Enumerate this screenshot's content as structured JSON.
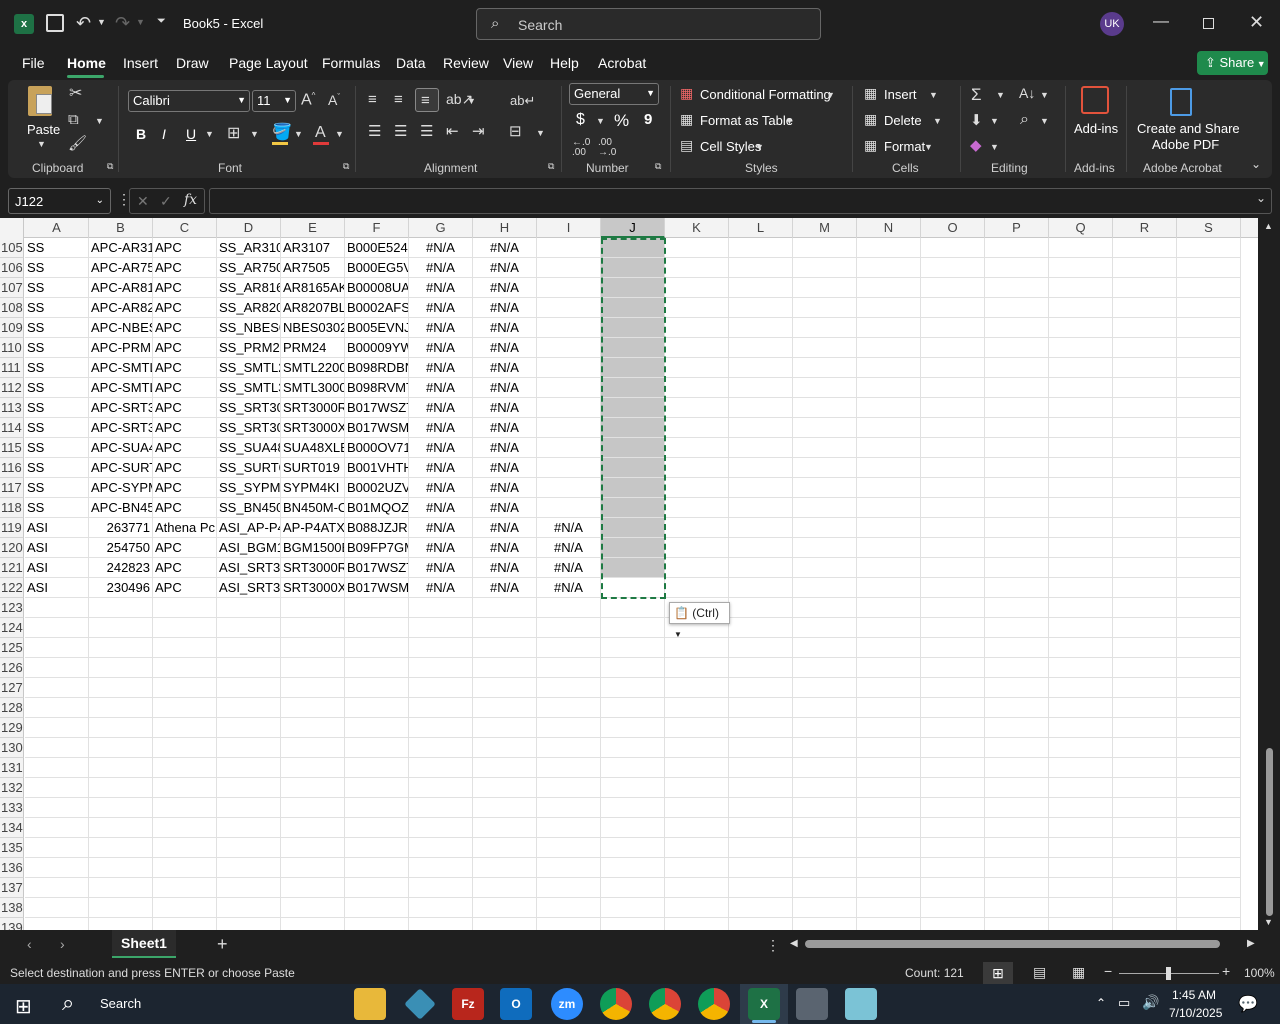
{
  "window": {
    "title": "Book5  -  Excel",
    "search_placeholder": "Search",
    "user_initials": "UK"
  },
  "menu_tabs": [
    "File",
    "Home",
    "Insert",
    "Draw",
    "Page Layout",
    "Formulas",
    "Data",
    "Review",
    "View",
    "Help",
    "Acrobat"
  ],
  "share_label": "Share",
  "ribbon": {
    "clipboard": {
      "paste": "Paste",
      "label": "Clipboard"
    },
    "font": {
      "name": "Calibri",
      "size": "11",
      "label": "Font",
      "bold": "B",
      "italic": "I",
      "underline": "U"
    },
    "alignment": {
      "label": "Alignment"
    },
    "number": {
      "format": "General",
      "label": "Number",
      "currency": "$",
      "percent": "%",
      "comma": "9"
    },
    "styles": {
      "conditional": "Conditional Formatting",
      "table": "Format as Table",
      "cell_styles": "Cell Styles",
      "label": "Styles"
    },
    "cells": {
      "insert": "Insert",
      "delete": "Delete",
      "format": "Format",
      "label": "Cells"
    },
    "editing": {
      "label": "Editing"
    },
    "addins": {
      "button": "Add-ins",
      "label": "Add-ins"
    },
    "acrobat": {
      "button_line1": "Create and Share",
      "button_line2": "Adobe PDF",
      "label": "Adobe Acrobat"
    }
  },
  "name_box": "J122",
  "columns": [
    "A",
    "B",
    "C",
    "D",
    "E",
    "F",
    "G",
    "H",
    "I",
    "J",
    "K",
    "L",
    "M",
    "N",
    "O",
    "P",
    "Q",
    "R",
    "S"
  ],
  "rows": [
    {
      "n": "105",
      "c": [
        "SS",
        "APC-AR31",
        "APC",
        "SS_AR310",
        "AR3107",
        "B000E5249",
        "#N/A",
        "#N/A",
        ""
      ]
    },
    {
      "n": "106",
      "c": [
        "SS",
        "APC-AR75",
        "APC",
        "SS_AR750",
        "AR7505",
        "B000EG5V",
        "#N/A",
        "#N/A",
        ""
      ]
    },
    {
      "n": "107",
      "c": [
        "SS",
        "APC-AR81",
        "APC",
        "SS_AR816",
        "AR8165AK",
        "B00008UA",
        "#N/A",
        "#N/A",
        ""
      ]
    },
    {
      "n": "108",
      "c": [
        "SS",
        "APC-AR82",
        "APC",
        "SS_AR820",
        "AR8207BL",
        "B0002AFS",
        "#N/A",
        "#N/A",
        ""
      ]
    },
    {
      "n": "109",
      "c": [
        "SS",
        "APC-NBES",
        "APC",
        "SS_NBES0",
        "NBES0302",
        "B005EVNJ",
        "#N/A",
        "#N/A",
        ""
      ]
    },
    {
      "n": "110",
      "c": [
        "SS",
        "APC-PRM",
        "APC",
        "SS_PRM24",
        "PRM24",
        "B00009YW",
        "#N/A",
        "#N/A",
        ""
      ]
    },
    {
      "n": "111",
      "c": [
        "SS",
        "APC-SMTL",
        "APC",
        "SS_SMTL2",
        "SMTL2200",
        "B098RDBN",
        "#N/A",
        "#N/A",
        ""
      ]
    },
    {
      "n": "112",
      "c": [
        "SS",
        "APC-SMTL",
        "APC",
        "SS_SMTL3",
        "SMTL3000",
        "B098RVMT",
        "#N/A",
        "#N/A",
        ""
      ]
    },
    {
      "n": "113",
      "c": [
        "SS",
        "APC-SRT3",
        "APC",
        "SS_SRT30",
        "SRT3000RI",
        "B017WSZT",
        "#N/A",
        "#N/A",
        ""
      ]
    },
    {
      "n": "114",
      "c": [
        "SS",
        "APC-SRT3",
        "APC",
        "SS_SRT30",
        "SRT3000XI",
        "B017WSM",
        "#N/A",
        "#N/A",
        ""
      ]
    },
    {
      "n": "115",
      "c": [
        "SS",
        "APC-SUA4",
        "APC",
        "SS_SUA48",
        "SUA48XLB",
        "B000OV71",
        "#N/A",
        "#N/A",
        ""
      ]
    },
    {
      "n": "116",
      "c": [
        "SS",
        "APC-SURT",
        "APC",
        "SS_SURT0",
        "SURT019",
        "B001VHTH",
        "#N/A",
        "#N/A",
        ""
      ]
    },
    {
      "n": "117",
      "c": [
        "SS",
        "APC-SYPM",
        "APC",
        "SS_SYPM4",
        "SYPM4KI",
        "B0002UZV",
        "#N/A",
        "#N/A",
        ""
      ]
    },
    {
      "n": "118",
      "c": [
        "SS",
        "APC-BN45",
        "APC",
        "SS_BN450",
        "BN450M-C",
        "B01MQOZ",
        "#N/A",
        "#N/A",
        ""
      ]
    },
    {
      "n": "119",
      "c": [
        "ASI",
        "263771",
        "Athena Pc",
        "ASI_AP-P4",
        "AP-P4ATX",
        "B088JZJRL",
        "#N/A",
        "#N/A",
        "#N/A"
      ]
    },
    {
      "n": "120",
      "c": [
        "ASI",
        "254750",
        "APC",
        "ASI_BGM1",
        "BGM1500E",
        "B09FP7GM",
        "#N/A",
        "#N/A",
        "#N/A"
      ]
    },
    {
      "n": "121",
      "c": [
        "ASI",
        "242823",
        "APC",
        "ASI_SRT3C",
        "SRT3000RI",
        "B017WSZT",
        "#N/A",
        "#N/A",
        "#N/A"
      ]
    },
    {
      "n": "122",
      "c": [
        "ASI",
        "230496",
        "APC",
        "ASI_SRT3C",
        "SRT3000XI",
        "B017WSM",
        "#N/A",
        "#N/A",
        "#N/A"
      ]
    },
    {
      "n": "123",
      "c": []
    },
    {
      "n": "124",
      "c": []
    },
    {
      "n": "125",
      "c": []
    },
    {
      "n": "126",
      "c": []
    },
    {
      "n": "127",
      "c": []
    },
    {
      "n": "128",
      "c": []
    },
    {
      "n": "129",
      "c": []
    },
    {
      "n": "130",
      "c": []
    },
    {
      "n": "131",
      "c": []
    },
    {
      "n": "132",
      "c": []
    },
    {
      "n": "133",
      "c": []
    },
    {
      "n": "134",
      "c": []
    },
    {
      "n": "135",
      "c": []
    },
    {
      "n": "136",
      "c": []
    },
    {
      "n": "137",
      "c": []
    },
    {
      "n": "138",
      "c": []
    },
    {
      "n": "139",
      "c": []
    }
  ],
  "paste_options": "(Ctrl)",
  "sheet_tab": "Sheet1",
  "status": {
    "message": "Select destination and press ENTER or choose Paste",
    "count": "Count: 121",
    "zoom": "100%"
  },
  "taskbar": {
    "search": "Search",
    "time": "1:45 AM",
    "date": "7/10/2025"
  },
  "colors": {
    "accent_green": "#1e7a43",
    "selection_gray": "#c6c6c6",
    "share_green": "#1f8a4c"
  }
}
